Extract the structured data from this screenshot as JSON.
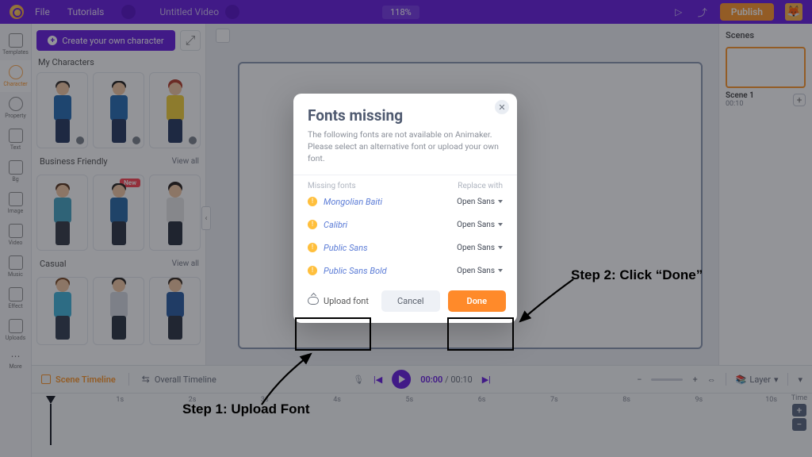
{
  "topbar": {
    "file": "File",
    "tutorials": "Tutorials",
    "title": "Untitled Video",
    "zoom": "118%",
    "publish": "Publish"
  },
  "rail": [
    {
      "label": "Templates"
    },
    {
      "label": "Character",
      "active": true
    },
    {
      "label": "Property"
    },
    {
      "label": "Text"
    },
    {
      "label": "Bg"
    },
    {
      "label": "Image"
    },
    {
      "label": "Video"
    },
    {
      "label": "Music"
    },
    {
      "label": "Effect"
    },
    {
      "label": "Uploads"
    },
    {
      "label": "More"
    }
  ],
  "panel": {
    "create": "Create your own character",
    "sections": {
      "my": "My Characters",
      "biz": "Business Friendly",
      "casual": "Casual",
      "viewall": "View all",
      "new": "New"
    }
  },
  "scenes": {
    "title": "Scenes",
    "scene1": "Scene 1",
    "time": "00:10"
  },
  "timeline": {
    "tab_scene": "Scene Timeline",
    "tab_overall": "Overall Timeline",
    "current": "00:00",
    "total": "00:10",
    "layer": "Layer",
    "col_time": "Time",
    "ticks": [
      "1s",
      "2s",
      "3s",
      "4s",
      "5s",
      "6s",
      "7s",
      "8s",
      "9s",
      "10s"
    ]
  },
  "modal": {
    "title": "Fonts missing",
    "sub": "The following fonts are not available on Animaker. Please select an alternative font or upload your own font.",
    "col_missing": "Missing fonts",
    "col_replace": "Replace with",
    "replace_value": "Open Sans",
    "fonts": [
      "Mongolian Baiti",
      "Calibri",
      "Public Sans",
      "Public Sans Bold"
    ],
    "upload": "Upload font",
    "cancel": "Cancel",
    "done": "Done"
  },
  "annotations": {
    "step1": "Step 1: Upload Font",
    "step2": "Step 2: Click “Done”"
  }
}
